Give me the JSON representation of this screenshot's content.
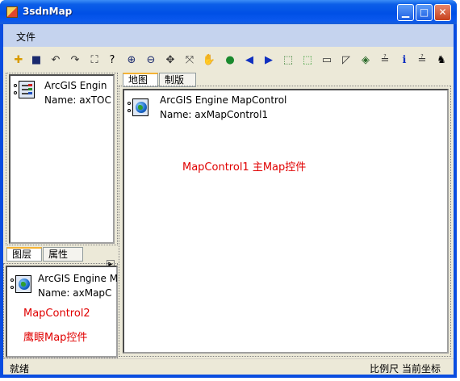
{
  "window": {
    "title": "3sdnMap"
  },
  "menu": {
    "file": "文件"
  },
  "toolbar": {
    "tools": [
      {
        "name": "add-data-icon",
        "glyph": "✚",
        "color": "#d99b00"
      },
      {
        "name": "save-icon",
        "glyph": "■",
        "color": "#1a2a6e"
      },
      {
        "name": "undo-icon",
        "glyph": "↶",
        "color": "#333333"
      },
      {
        "name": "redo-icon",
        "glyph": "↷",
        "color": "#333333"
      },
      {
        "name": "full-extent-icon",
        "glyph": "⛶",
        "color": "#333333"
      },
      {
        "name": "whats-this-icon",
        "glyph": "?",
        "color": "#000000"
      },
      {
        "name": "zoom-in-icon",
        "glyph": "⊕",
        "color": "#1a2a6e"
      },
      {
        "name": "zoom-out-icon",
        "glyph": "⊖",
        "color": "#1a2a6e"
      },
      {
        "name": "fixed-zoom-in-icon",
        "glyph": "✥",
        "color": "#333333"
      },
      {
        "name": "fixed-zoom-out-icon",
        "glyph": "⤧",
        "color": "#333333"
      },
      {
        "name": "pan-icon",
        "glyph": "✋",
        "color": "#333333"
      },
      {
        "name": "globe-icon",
        "glyph": "●",
        "color": "#1a8a2e"
      },
      {
        "name": "back-icon",
        "glyph": "◀",
        "color": "#1030c0"
      },
      {
        "name": "forward-icon",
        "glyph": "▶",
        "color": "#1030c0"
      },
      {
        "name": "select-features-icon",
        "glyph": "⬚",
        "color": "#2a7a2a"
      },
      {
        "name": "clear-selection-icon",
        "glyph": "⬚",
        "color": "#2a9a2a"
      },
      {
        "name": "map-tips-icon",
        "glyph": "▭",
        "color": "#333333"
      },
      {
        "name": "select-elements-icon",
        "glyph": "◸",
        "color": "#333333"
      },
      {
        "name": "find-icon",
        "glyph": "◈",
        "color": "#2a6a2a"
      },
      {
        "name": "measure-icon",
        "glyph": "≟",
        "color": "#333333"
      },
      {
        "name": "identify-icon",
        "glyph": "ℹ",
        "color": "#1030c0"
      },
      {
        "name": "go-to-xy-icon",
        "glyph": "≟",
        "color": "#333333"
      },
      {
        "name": "search-icon",
        "glyph": "♞",
        "color": "#000000"
      }
    ]
  },
  "toc": {
    "line1": "ArcGIS Engin",
    "line2": "Name: axTOC"
  },
  "left_tabs": {
    "layers": "图层",
    "properties": "属性"
  },
  "overview": {
    "line1": "ArcGIS Engine M",
    "line2": "Name: axMapC",
    "note1": "MapControl2",
    "note2": "鹰眼Map控件"
  },
  "right_tabs": {
    "map": "地图",
    "layout": "制版"
  },
  "map": {
    "line1": "ArcGIS Engine MapControl",
    "line2": "Name: axMapControl1",
    "note": "MapControl1 主Map控件"
  },
  "status": {
    "ready": "就绪",
    "scale": "比例尺",
    "coords": "当前坐标"
  },
  "colors": {
    "title_bar": "#0a4de0",
    "menu_bar": "#c5d3ee",
    "face": "#ece9d8",
    "annotation": "#e00000"
  }
}
